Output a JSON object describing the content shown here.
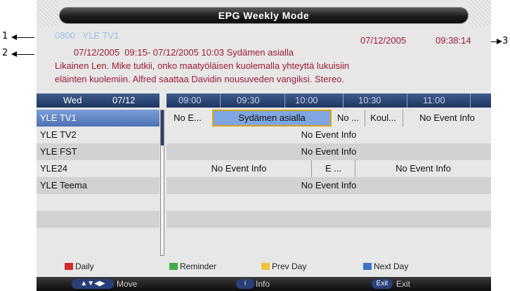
{
  "callouts": {
    "c1": "1",
    "c2": "2",
    "c3": "3"
  },
  "title": "EPG Weekly Mode",
  "info": {
    "channel_number": "0800",
    "channel_name": "YLE TV1",
    "current_date": "07/12/2005",
    "current_time": "09:38:14",
    "event_line": "07/12/2005  09:15- 07/12/2005 10:03 Sydämen asialla",
    "desc_line1": "Likainen Len. Mike tutkii, onko maatyöläisen kuolemalla yhteyttä lukuisiin",
    "desc_line2": "eläinten kuolemiin. Alfred saattaa Davidin nousuveden vangiksi. Stereo."
  },
  "header": {
    "day": "Wed",
    "date": "07/12",
    "times": [
      "09:00",
      "09:30",
      "10:00",
      "10:30",
      "11:00"
    ]
  },
  "channels": [
    {
      "name": "YLE TV1"
    },
    {
      "name": "YLE TV2"
    },
    {
      "name": "YLE FST"
    },
    {
      "name": "YLE24"
    },
    {
      "name": "YLE Teema"
    }
  ],
  "events": {
    "tv1": [
      "No E...",
      "Sydämen asialla",
      "No ...",
      "Koul...",
      "No Event Info"
    ],
    "tv2": [
      "No Event Info"
    ],
    "fst": [
      "No Event Info"
    ],
    "yle24": [
      "No Event Info",
      "E ...",
      "No Event Info"
    ],
    "teema": [
      "No Event Info"
    ]
  },
  "legend": {
    "red": "Daily",
    "green": "Reminder",
    "yellow": "Prev Day",
    "blue": "Next Day"
  },
  "colors": {
    "red": "#d42a2a",
    "green": "#3fae49",
    "yellow": "#f2c23a",
    "blue": "#3c73c7"
  },
  "footer": {
    "move_key": "▲▼◀▶",
    "move": "Move",
    "info_key": "i",
    "info": "Info",
    "exit_key": "Exit",
    "exit": "Exit"
  }
}
